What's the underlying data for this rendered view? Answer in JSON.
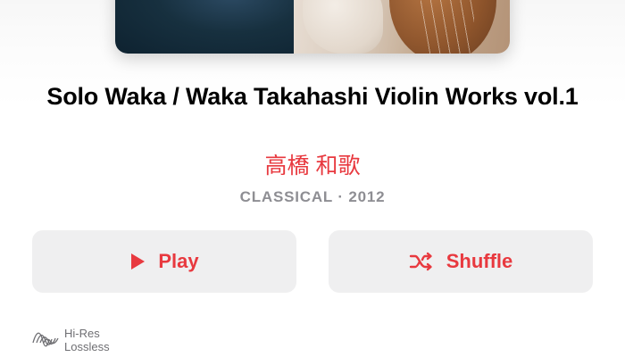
{
  "album": {
    "title": "Solo Waka / Waka Takahashi Violin Works vol.1",
    "artist": "高橋 和歌",
    "meta": "CLASSICAL · 2012"
  },
  "buttons": {
    "play_label": "Play",
    "shuffle_label": "Shuffle"
  },
  "badge": {
    "line1": "Hi-Res",
    "line2": "Lossless"
  },
  "icons": {
    "play": "play-icon",
    "shuffle": "shuffle-icon",
    "hires": "hi-res-lossless-icon"
  },
  "colors": {
    "accent": "#e8393f",
    "button_bg": "#efeff0",
    "meta_text": "#8e8e93"
  }
}
